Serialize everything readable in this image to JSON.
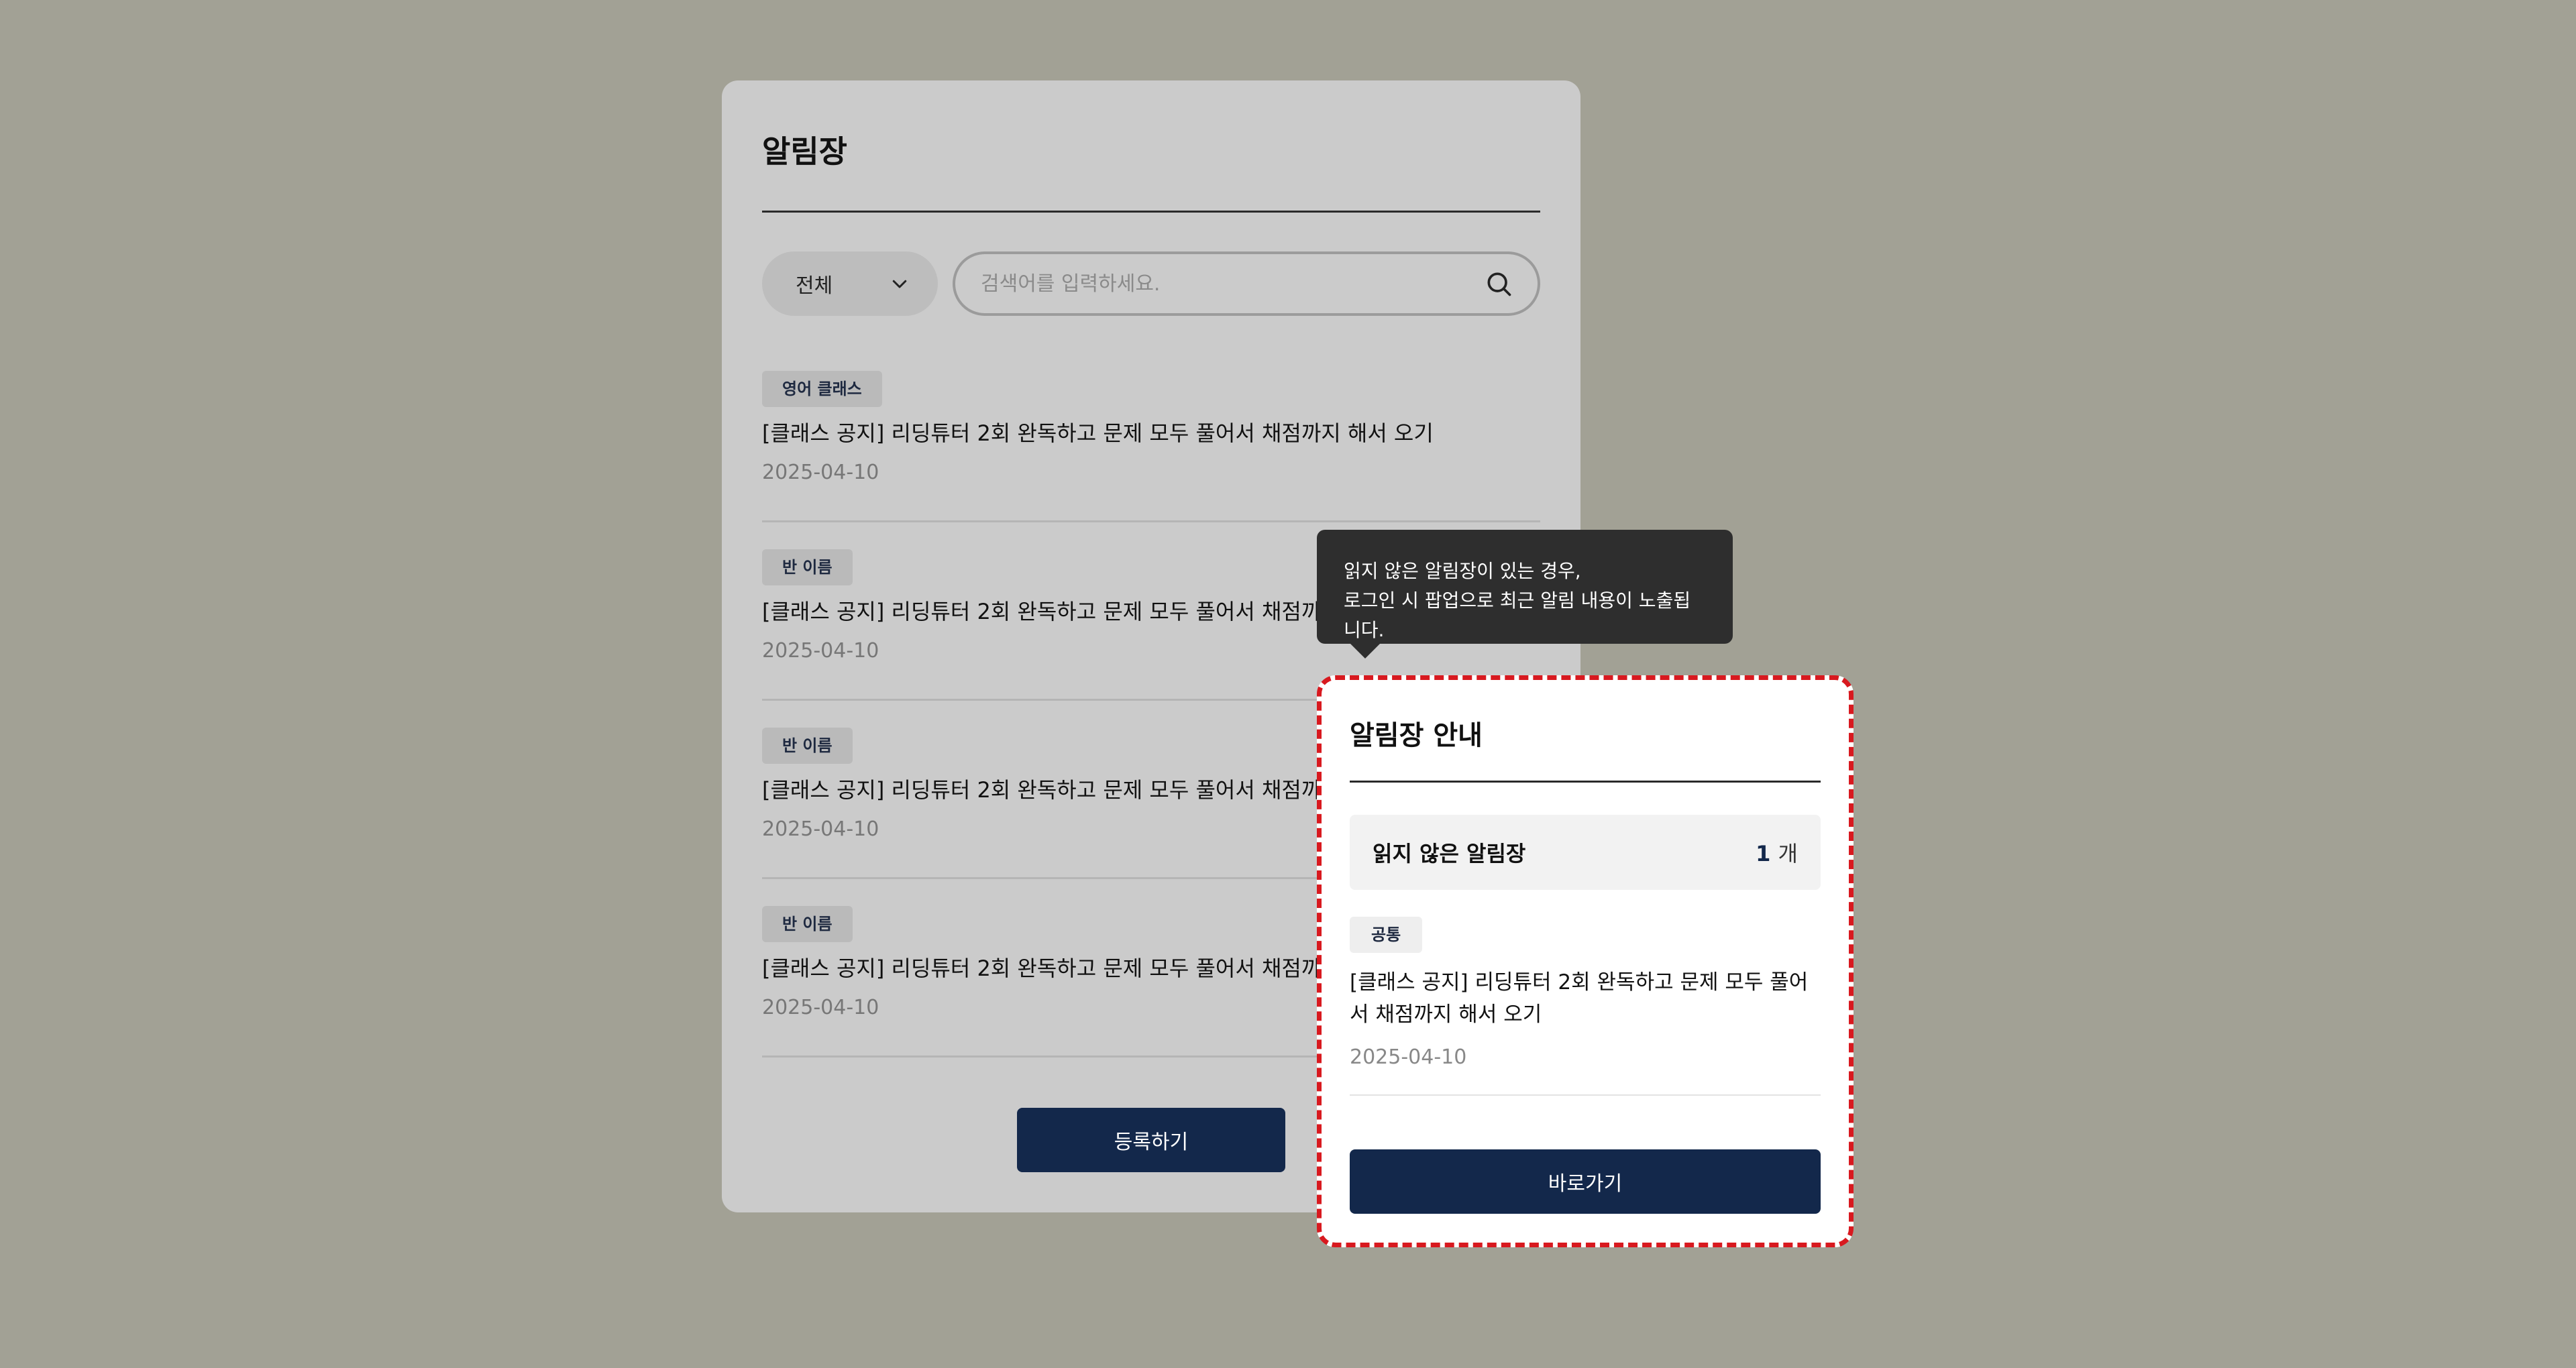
{
  "board": {
    "title": "알림장",
    "filter": {
      "selected": "전체"
    },
    "search": {
      "placeholder": "검색어를 입력하세요."
    },
    "notices": [
      {
        "tag": "영어 클래스",
        "title": "[클래스 공지] 리딩튜터 2회 완독하고 문제 모두 풀어서 채점까지 해서 오기",
        "date": "2025-04-10"
      },
      {
        "tag": "반 이름",
        "title": "[클래스 공지] 리딩튜터 2회 완독하고 문제 모두 풀어서 채점까지 해서 오기",
        "date": "2025-04-10"
      },
      {
        "tag": "반 이름",
        "title": "[클래스 공지] 리딩튜터 2회 완독하고 문제 모두 풀어서 채점까지 해서 오기",
        "date": "2025-04-10"
      },
      {
        "tag": "반 이름",
        "title": "[클래스 공지] 리딩튜터 2회 완독하고 문제 모두 풀어서 채점까지 해서 오기",
        "date": "2025-04-10"
      }
    ],
    "register_label": "등록하기"
  },
  "tooltip": {
    "line1": "읽지 않은 알림장이 있는 경우,",
    "line2": "로그인 시 팝업으로 최근 알림 내용이 노출됩니다."
  },
  "popup": {
    "title": "알림장 안내",
    "unread_label": "읽지 않은 알림장",
    "unread_count": "1",
    "unread_unit": "개",
    "notice": {
      "tag": "공통",
      "title": "[클래스 공지] 리딩튜터 2회 완독하고 문제 모두 풀어서 채점까지 해서 오기",
      "date": "2025-04-10"
    },
    "goto_label": "바로가기"
  },
  "colors": {
    "brand": "#13284b",
    "highlight_border": "#d8191f",
    "backdrop": "#a2a195"
  }
}
